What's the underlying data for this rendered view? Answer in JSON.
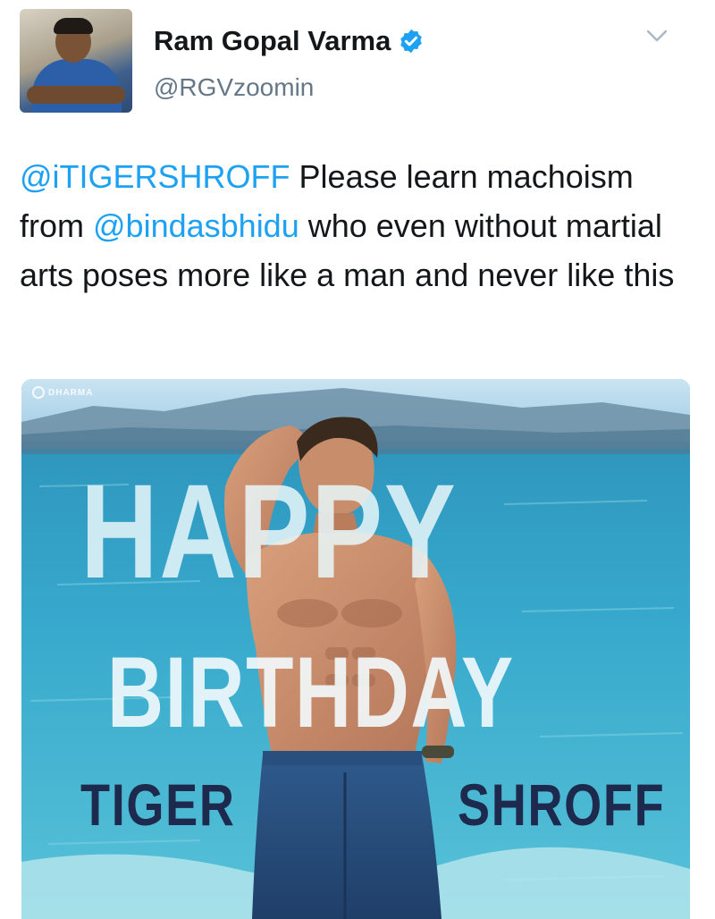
{
  "tweet": {
    "author": {
      "display_name": "Ram Gopal Varma",
      "handle": "@RGVzoomin",
      "verified": true
    },
    "text_segments": [
      {
        "type": "mention",
        "text": "@iTIGERSHROFF"
      },
      {
        "type": "text",
        "text": " Please learn machoism from "
      },
      {
        "type": "mention",
        "text": "@bindasbhidu"
      },
      {
        "type": "text",
        "text": " who even without martial arts poses more like a man and never like this"
      }
    ],
    "media": {
      "headline_line1": "HAPPY",
      "headline_line2": "BIRTHDAY",
      "name_first": "TIGER",
      "name_last": "SHROFF",
      "watermark": "DHARMA"
    }
  },
  "colors": {
    "link": "#1da1f2",
    "verified_badge": "#1da1f2",
    "text_primary": "#14171a",
    "text_secondary": "#657786",
    "name_banner_text": "#1d2a4d"
  },
  "icons": {
    "verified": "verified-badge-icon",
    "menu": "chevron-down-icon"
  }
}
